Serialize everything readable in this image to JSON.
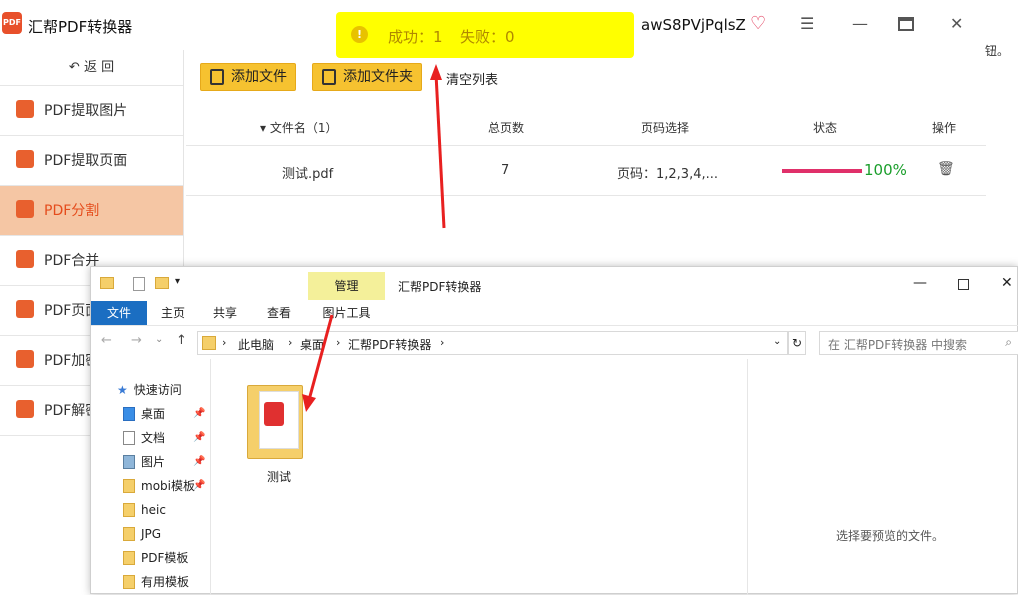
{
  "app": {
    "title": "汇帮PDF转换器",
    "logo": "PDF",
    "user": "awS8PVjPqlsZ",
    "back": "返 回"
  },
  "toolbar": {
    "add_file": "添加文件",
    "add_folder": "添加文件夹",
    "clear": "清空列表"
  },
  "sidebar": {
    "items": [
      {
        "label": "PDF提取图片"
      },
      {
        "label": "PDF提取页面"
      },
      {
        "label": "PDF分割"
      },
      {
        "label": "PDF合并"
      },
      {
        "label": "PDF页面"
      },
      {
        "label": "PDF加密"
      },
      {
        "label": "PDF解密"
      }
    ]
  },
  "table": {
    "headers": {
      "name": "▾ 文件名（1）",
      "pages": "总页数",
      "range": "页码选择",
      "status": "状态",
      "op": "操作"
    },
    "rows": [
      {
        "name": "测试.pdf",
        "pages": "7",
        "range": "页码：1,2,3,4,...",
        "progress": "100%"
      }
    ]
  },
  "toast": {
    "success": "成功：1",
    "fail": "失败：0"
  },
  "side_hint": "钮。",
  "explorer": {
    "manage_tab": "管理",
    "title": "汇帮PDF转换器",
    "tabs": [
      "文件",
      "主页",
      "共享",
      "查看",
      "图片工具"
    ],
    "path": [
      "此电脑",
      "桌面",
      "汇帮PDF转换器"
    ],
    "search_placeholder": "在 汇帮PDF转换器 中搜索",
    "nav": [
      "快速访问",
      "桌面",
      "文档",
      "图片",
      "mobi模板",
      "heic",
      "JPG",
      "PDF模板",
      "有用模板"
    ],
    "file_name": "测试",
    "preview_hint": "选择要预览的文件。"
  },
  "colors": {
    "accent": "#e8602e",
    "progress": "#e0306a",
    "done": "#1a9e2b",
    "toast": "#ffff00"
  }
}
